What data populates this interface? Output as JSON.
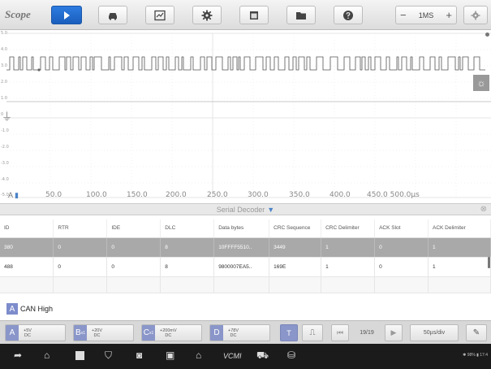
{
  "app": {
    "brand": "Scope"
  },
  "toolbar": {
    "icons": [
      "play-icon",
      "car-icon",
      "chart-icon",
      "gear-icon",
      "window-icon",
      "folder-icon",
      "help-icon"
    ],
    "timebase": {
      "minus": "−",
      "value": "1MS",
      "plus": "+"
    },
    "settings_icon": "tools-icon"
  },
  "scope": {
    "y_ticks": [
      "5.0",
      "4.0",
      "3.0",
      "2.0",
      "1.0",
      "0",
      "-1.0",
      "-2.0",
      "-3.0",
      "-4.0",
      "-5.0"
    ],
    "x_ticks": [
      "50.0",
      "100.0",
      "150.0",
      "200.0",
      "250.0",
      "300.0",
      "350.0",
      "400.0",
      "450.0 500.0µs"
    ],
    "x_start": "0",
    "channel_marker": "A"
  },
  "decoder": {
    "title": "Serial Decoder",
    "columns": [
      "ID",
      "RTR",
      "IDE",
      "DLC",
      "Data bytes",
      "CRC Sequence",
      "CRC Delimiter",
      "ACK Slot",
      "ACK Delimiter"
    ],
    "rows": [
      [
        "380",
        "0",
        "0",
        "8",
        "10FFFF5510..",
        "3449",
        "1",
        "0",
        "1"
      ],
      [
        "488",
        "0",
        "0",
        "8",
        "9800007EA5..",
        "169E",
        "1",
        "0",
        "1"
      ]
    ],
    "selected_row": 0
  },
  "channel_label": {
    "letter": "A",
    "name": "CAN High"
  },
  "channels": [
    {
      "letter": "A",
      "sub": "",
      "top": "+5V",
      "bottom": "DC"
    },
    {
      "letter": "B",
      "sub": "x1",
      "top": "+20V",
      "bottom": "DC"
    },
    {
      "letter": "C",
      "sub": "x1",
      "top": "+200mV",
      "bottom": "DC"
    },
    {
      "letter": "D",
      "sub": "",
      "top": "+78V",
      "bottom": "DC"
    }
  ],
  "playback": {
    "page": "19/19",
    "timediv": "50µs/div"
  },
  "navbar": {
    "status": "✱ 98% ▮ 17:4",
    "vcm_label": "VCMI"
  }
}
